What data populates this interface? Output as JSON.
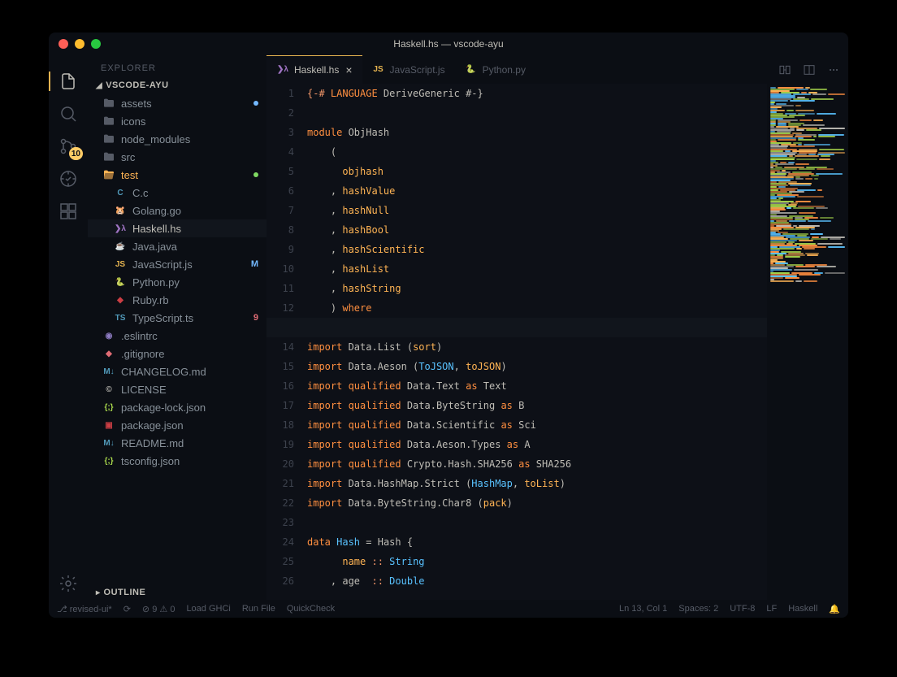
{
  "window_title": "Haskell.hs — vscode-ayu",
  "activitybar": {
    "items": [
      {
        "name": "files-icon",
        "active": true
      },
      {
        "name": "search-icon"
      },
      {
        "name": "source-control-icon",
        "badge": "10"
      },
      {
        "name": "debug-icon"
      },
      {
        "name": "extensions-icon"
      }
    ],
    "bottom": [
      {
        "name": "settings-icon"
      }
    ]
  },
  "sidebar": {
    "title": "EXPLORER",
    "project": "VSCODE-AYU",
    "tree": [
      {
        "type": "folder",
        "label": "assets",
        "indent": 1,
        "deco": "dot-blue"
      },
      {
        "type": "folder",
        "label": "icons",
        "indent": 1
      },
      {
        "type": "folder",
        "label": "node_modules",
        "indent": 1
      },
      {
        "type": "folder",
        "label": "src",
        "indent": 1
      },
      {
        "type": "folder-open",
        "label": "test",
        "indent": 1,
        "deco": "dot-green",
        "color": "#ffb454"
      },
      {
        "type": "file",
        "label": "C.c",
        "indent": 2,
        "icon": "c"
      },
      {
        "type": "file",
        "label": "Golang.go",
        "indent": 2,
        "icon": "go"
      },
      {
        "type": "file",
        "label": "Haskell.hs",
        "indent": 2,
        "icon": "hs",
        "selected": true
      },
      {
        "type": "file",
        "label": "Java.java",
        "indent": 2,
        "icon": "java"
      },
      {
        "type": "file",
        "label": "JavaScript.js",
        "indent": 2,
        "icon": "js",
        "deco": "M"
      },
      {
        "type": "file",
        "label": "Python.py",
        "indent": 2,
        "icon": "py"
      },
      {
        "type": "file",
        "label": "Ruby.rb",
        "indent": 2,
        "icon": "rb"
      },
      {
        "type": "file",
        "label": "TypeScript.ts",
        "indent": 2,
        "icon": "ts",
        "deco": "9"
      },
      {
        "type": "file",
        "label": ".eslintrc",
        "indent": 1,
        "icon": "eslint"
      },
      {
        "type": "file",
        "label": ".gitignore",
        "indent": 1,
        "icon": "git"
      },
      {
        "type": "file",
        "label": "CHANGELOG.md",
        "indent": 1,
        "icon": "md"
      },
      {
        "type": "file",
        "label": "LICENSE",
        "indent": 1,
        "icon": "license"
      },
      {
        "type": "file",
        "label": "package-lock.json",
        "indent": 1,
        "icon": "json"
      },
      {
        "type": "file",
        "label": "package.json",
        "indent": 1,
        "icon": "npm"
      },
      {
        "type": "file",
        "label": "README.md",
        "indent": 1,
        "icon": "md"
      },
      {
        "type": "file",
        "label": "tsconfig.json",
        "indent": 1,
        "icon": "json"
      }
    ],
    "outline_label": "OUTLINE"
  },
  "tabs": [
    {
      "label": "Haskell.hs",
      "icon": "hs",
      "active": true,
      "closable": true
    },
    {
      "label": "JavaScript.js",
      "icon": "js"
    },
    {
      "label": "Python.py",
      "icon": "py"
    }
  ],
  "code": {
    "lines": [
      [
        {
          "t": "{-# ",
          "c": "op"
        },
        {
          "t": "LANGUAGE",
          "c": "kw"
        },
        {
          "t": " DeriveGeneric #-}",
          "c": ""
        }
      ],
      [
        {
          "t": ""
        }
      ],
      [
        {
          "t": "module ",
          "c": "kw"
        },
        {
          "t": "ObjHash",
          "c": ""
        }
      ],
      [
        {
          "t": "    ("
        }
      ],
      [
        {
          "t": "      "
        },
        {
          "t": "objhash",
          "c": "func"
        }
      ],
      [
        {
          "t": "    , "
        },
        {
          "t": "hashValue",
          "c": "func"
        }
      ],
      [
        {
          "t": "    , "
        },
        {
          "t": "hashNull",
          "c": "func"
        }
      ],
      [
        {
          "t": "    , "
        },
        {
          "t": "hashBool",
          "c": "func"
        }
      ],
      [
        {
          "t": "    , "
        },
        {
          "t": "hashScientific",
          "c": "func"
        }
      ],
      [
        {
          "t": "    , "
        },
        {
          "t": "hashList",
          "c": "func"
        }
      ],
      [
        {
          "t": "    , "
        },
        {
          "t": "hashString",
          "c": "func"
        }
      ],
      [
        {
          "t": "    ) "
        },
        {
          "t": "where",
          "c": "kw"
        }
      ],
      [
        {
          "t": ""
        }
      ],
      [
        {
          "t": "import ",
          "c": "kw"
        },
        {
          "t": "Data.List ("
        },
        {
          "t": "sort",
          "c": "func"
        },
        {
          "t": ")"
        }
      ],
      [
        {
          "t": "import ",
          "c": "kw"
        },
        {
          "t": "Data.Aeson ("
        },
        {
          "t": "ToJSON",
          "c": "type"
        },
        {
          "t": ", "
        },
        {
          "t": "toJSON",
          "c": "func"
        },
        {
          "t": ")"
        }
      ],
      [
        {
          "t": "import ",
          "c": "kw"
        },
        {
          "t": "qualified",
          "c": "kw"
        },
        {
          "t": " Data.Text "
        },
        {
          "t": "as",
          "c": "kw"
        },
        {
          "t": " Text"
        }
      ],
      [
        {
          "t": "import ",
          "c": "kw"
        },
        {
          "t": "qualified",
          "c": "kw"
        },
        {
          "t": " Data.ByteString "
        },
        {
          "t": "as",
          "c": "kw"
        },
        {
          "t": " B"
        }
      ],
      [
        {
          "t": "import ",
          "c": "kw"
        },
        {
          "t": "qualified",
          "c": "kw"
        },
        {
          "t": " Data.Scientific "
        },
        {
          "t": "as",
          "c": "kw"
        },
        {
          "t": " Sci"
        }
      ],
      [
        {
          "t": "import ",
          "c": "kw"
        },
        {
          "t": "qualified",
          "c": "kw"
        },
        {
          "t": " Data.Aeson.Types "
        },
        {
          "t": "as",
          "c": "kw"
        },
        {
          "t": " A"
        }
      ],
      [
        {
          "t": "import ",
          "c": "kw"
        },
        {
          "t": "qualified",
          "c": "kw"
        },
        {
          "t": " Crypto.Hash.SHA256 "
        },
        {
          "t": "as",
          "c": "kw"
        },
        {
          "t": " SHA256"
        }
      ],
      [
        {
          "t": "import ",
          "c": "kw"
        },
        {
          "t": "Data.HashMap.Strict ("
        },
        {
          "t": "HashMap",
          "c": "type"
        },
        {
          "t": ", "
        },
        {
          "t": "toList",
          "c": "func"
        },
        {
          "t": ")"
        }
      ],
      [
        {
          "t": "import ",
          "c": "kw"
        },
        {
          "t": "Data.ByteString.Char8 ("
        },
        {
          "t": "pack",
          "c": "func"
        },
        {
          "t": ")"
        }
      ],
      [
        {
          "t": ""
        }
      ],
      [
        {
          "t": "data ",
          "c": "kw"
        },
        {
          "t": "Hash",
          "c": "type"
        },
        {
          "t": " = "
        },
        {
          "t": "Hash",
          "c": ""
        },
        {
          "t": " {"
        }
      ],
      [
        {
          "t": "      "
        },
        {
          "t": "name",
          "c": "func"
        },
        {
          "t": " :: ",
          "c": "op"
        },
        {
          "t": "String",
          "c": "type"
        }
      ],
      [
        {
          "t": "    , "
        },
        {
          "t": "age  ",
          "c": ""
        },
        {
          "t": ":: ",
          "c": "op"
        },
        {
          "t": "Double",
          "c": "type"
        }
      ]
    ],
    "highlight_line": 13
  },
  "statusbar": {
    "branch": "revised-ui*",
    "sync": "⟳",
    "errors": "9",
    "warnings": "0",
    "tasks": [
      "Load GHCi",
      "Run File",
      "QuickCheck"
    ],
    "pos": "Ln 13, Col 1",
    "spaces": "Spaces: 2",
    "encoding": "UTF-8",
    "eol": "LF",
    "language": "Haskell"
  },
  "icons": {
    "c": {
      "color": "#519aba",
      "text": "C"
    },
    "go": {
      "color": "#519aba",
      "text": "🐹"
    },
    "hs": {
      "color": "#a074c4",
      "text": "❯λ"
    },
    "java": {
      "color": "#cc3e44",
      "text": "☕"
    },
    "js": {
      "color": "#e6b450",
      "text": "JS"
    },
    "py": {
      "color": "#519aba",
      "text": "🐍"
    },
    "rb": {
      "color": "#cc3e44",
      "text": "◆"
    },
    "ts": {
      "color": "#519aba",
      "text": "TS"
    },
    "eslint": {
      "color": "#8e7cc3",
      "text": "◉"
    },
    "git": {
      "color": "#e06c75",
      "text": "◆"
    },
    "md": {
      "color": "#519aba",
      "text": "M↓"
    },
    "license": {
      "color": "#bfbdb6",
      "text": "©"
    },
    "json": {
      "color": "#aad94c",
      "text": "{;}"
    },
    "npm": {
      "color": "#cc3e44",
      "text": "▣"
    }
  }
}
